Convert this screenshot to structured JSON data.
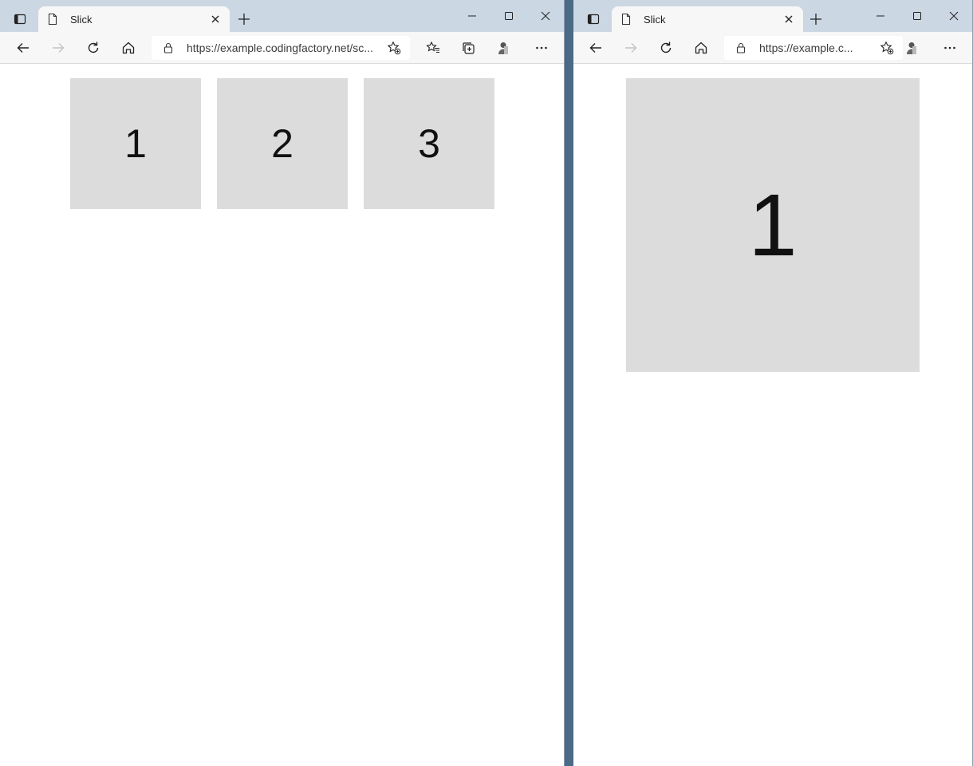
{
  "colors": {
    "titlebar": "#cbd7e3",
    "toolbar": "#f7f7f7",
    "slide_bg": "#dcdcdc",
    "slide_text": "#111111"
  },
  "left_window": {
    "tab_title": "Slick",
    "url": "https://example.codingfactory.net/sc...",
    "slides": [
      {
        "label": "1"
      },
      {
        "label": "2"
      },
      {
        "label": "3"
      }
    ]
  },
  "right_window": {
    "tab_title": "Slick",
    "url": "https://example.c...",
    "slides": [
      {
        "label": "1"
      }
    ]
  },
  "icons": [
    "tab-actions-icon",
    "page-icon",
    "close-icon",
    "plus-icon",
    "minimize-icon",
    "maximize-icon",
    "back-icon",
    "forward-icon",
    "refresh-icon",
    "home-icon",
    "lock-icon",
    "favorite-add-icon",
    "favorites-icon",
    "collections-icon",
    "profile-icon",
    "more-icon"
  ]
}
